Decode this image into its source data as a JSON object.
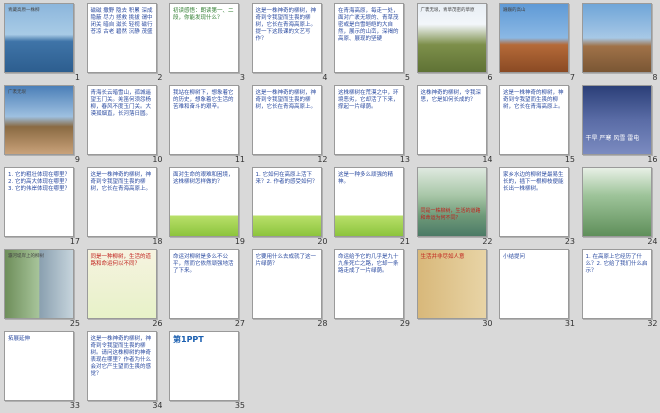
{
  "slides": [
    {
      "n": "1",
      "style": "photo-sea",
      "text": "青藏高原一株柳"
    },
    {
      "n": "2",
      "style": "text-list",
      "text": "磁磁 撒野 隐去 积累 深成 隐蔽 尽力 拯救 挑拔 谓中 闭关 暗自 滋长 轻视 磁行 苍凉 古老 碧然 沉静 茂盛"
    },
    {
      "n": "3",
      "style": "text-green",
      "text": "初读感悟：朗读第一、二段，你能发现什么？"
    },
    {
      "n": "4",
      "style": "text-blue",
      "text": "这是一株神奇的柳树，神奇到令我望而生畏的柳树，它长在青海高原上。提一下这段课的文艺写作？"
    },
    {
      "n": "5",
      "style": "text-blue",
      "text": "在青海高原，每走一处，面对广袤无垠的、青草茂密或是白雪皑皑的大自然，展示的山峦，深褐的高原、展现的坚硬"
    },
    {
      "n": "6",
      "style": "photo-grass",
      "text": "广袤无垠，青草茂密的草原"
    },
    {
      "n": "7",
      "style": "photo-rock",
      "text": "巍巍的高山"
    },
    {
      "n": "8",
      "style": "photo-mountain",
      "text": ""
    },
    {
      "n": "9",
      "style": "photo-collage",
      "text": "广袤无垠"
    },
    {
      "n": "10",
      "style": "text-poem",
      "text": "青海长云暗雪山，孤城遥望玉门关。羌笛何须怨杨柳，春风不度玉门关。大漠孤烟直，长河落日圆。"
    },
    {
      "n": "11",
      "style": "text-poem",
      "text": "我站在柳树下，想象着它的历史，想象着它生活的苦难和奋斗的艰辛。"
    },
    {
      "n": "12",
      "style": "text-blue",
      "text": "这是一株神奇的柳树，神奇到令我望而生畏的柳树，它长在青海高原上。"
    },
    {
      "n": "13",
      "style": "text-list2",
      "text": "这株柳树在荒漠之中，环境恶劣，它却活了下来，撑起一片绿荫。"
    },
    {
      "n": "14",
      "style": "text-list2",
      "text": "这株神奇的柳树，令我深思，它是如何长成的？"
    },
    {
      "n": "15",
      "style": "text-blue",
      "text": "这是一株神奇的柳树，神奇到令我望而生畏的柳树，它长在青海高原上。"
    },
    {
      "n": "16",
      "style": "photo-storm",
      "text": "干旱 严寒 风雪 雷电"
    },
    {
      "n": "17",
      "style": "text-qa",
      "text": "1. 它的粗壮体现在哪里？2. 它的高大体现在哪里？3. 它的伟岸体现在哪里？"
    },
    {
      "n": "18",
      "style": "text-blue",
      "text": "这是一株神奇的柳树，神奇到令我望而生畏的柳树，它长在青海高原上。"
    },
    {
      "n": "19",
      "style": "text-cartoon",
      "text": "面对生命的艰难和困境，这株柳树怎样做的？"
    },
    {
      "n": "20",
      "style": "text-cartoon2",
      "text": "1. 它如何在高原上活下来？2. 作者的感受如何？"
    },
    {
      "n": "21",
      "style": "text-cartoon3",
      "text": "这是一种多么顽强的精神。"
    },
    {
      "n": "22",
      "style": "photo-river",
      "text": "同是一株柳树，生活的道路和命运为何不同？"
    },
    {
      "n": "23",
      "style": "text-box",
      "text": "家乡水边的柳树是最易生长的，插下一根柳枝便能长出一株柳树。"
    },
    {
      "n": "24",
      "style": "photo-willow",
      "text": ""
    },
    {
      "n": "25",
      "style": "photo-duo",
      "text": "灞河堤岸上的柳树"
    },
    {
      "n": "26",
      "style": "text-banner",
      "text": "同是一种柳树，生活的道路和命运何以不同？"
    },
    {
      "n": "27",
      "style": "text-list2",
      "text": "命运对柳树是多么不公平，然而它依然顽强地活了下来。"
    },
    {
      "n": "28",
      "style": "text-list2",
      "text": "它要用什么去成就了这一片绿荫？"
    },
    {
      "n": "29",
      "style": "text-qa2",
      "text": "命运给予它的几乎是九十九条死亡之路，它却一条路走成了一片绿荫。"
    },
    {
      "n": "30",
      "style": "photo-portrait",
      "text": "生活并非尽如人意"
    },
    {
      "n": "31",
      "style": "text-notes",
      "text": "小结提问"
    },
    {
      "n": "32",
      "style": "text-notes2",
      "text": "1. 在高原上它经历了什么？2. 它给了我们什么启示？"
    },
    {
      "n": "33",
      "style": "text-notes3",
      "text": "拓展延伸"
    },
    {
      "n": "34",
      "style": "text-blue2",
      "text": "这是一株神奇的柳树，神奇到令我望而生畏的柳树。请问这株柳树的神奇表现在哪里？作者为什么会对它产生望而生畏的感觉？"
    },
    {
      "n": "35",
      "style": "ppt-logo",
      "text": "第1PPT"
    }
  ],
  "colors": {
    "bg": "#d9d9d9",
    "border": "#9a9a9a",
    "num": "#333333"
  }
}
